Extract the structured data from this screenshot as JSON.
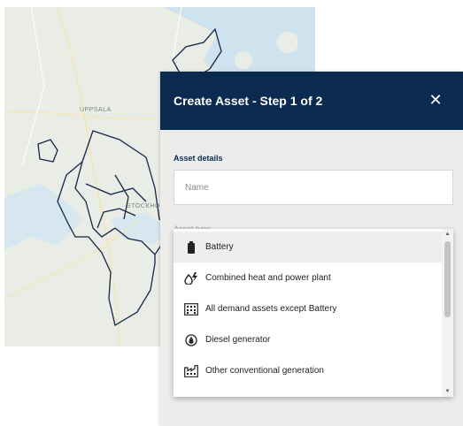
{
  "map": {
    "labels": {
      "uppsala": "UPPSALA",
      "stockholm": "STOCKHOLM"
    },
    "colors": {
      "land": "#e9ede5",
      "water": "#cfe3ee",
      "boundary": "#14264a"
    }
  },
  "dialog": {
    "title": "Create Asset - Step 1 of 2",
    "close_glyph": "✕",
    "section_label": "Asset details",
    "name_placeholder": "Name",
    "obscured_label": "Asset type",
    "header_color": "#0a2a4f"
  },
  "asset_type_dropdown": {
    "options": [
      {
        "label": "Battery",
        "icon": "battery-icon",
        "selected": true
      },
      {
        "label": "Combined heat and power plant",
        "icon": "fire-bolt-icon",
        "selected": false
      },
      {
        "label": "All demand assets except Battery",
        "icon": "building-icon",
        "selected": false
      },
      {
        "label": "Diesel generator",
        "icon": "fuel-drop-icon",
        "selected": false
      },
      {
        "label": "Other conventional generation",
        "icon": "factory-icon",
        "selected": false
      }
    ],
    "scroll_position": 0.0
  }
}
